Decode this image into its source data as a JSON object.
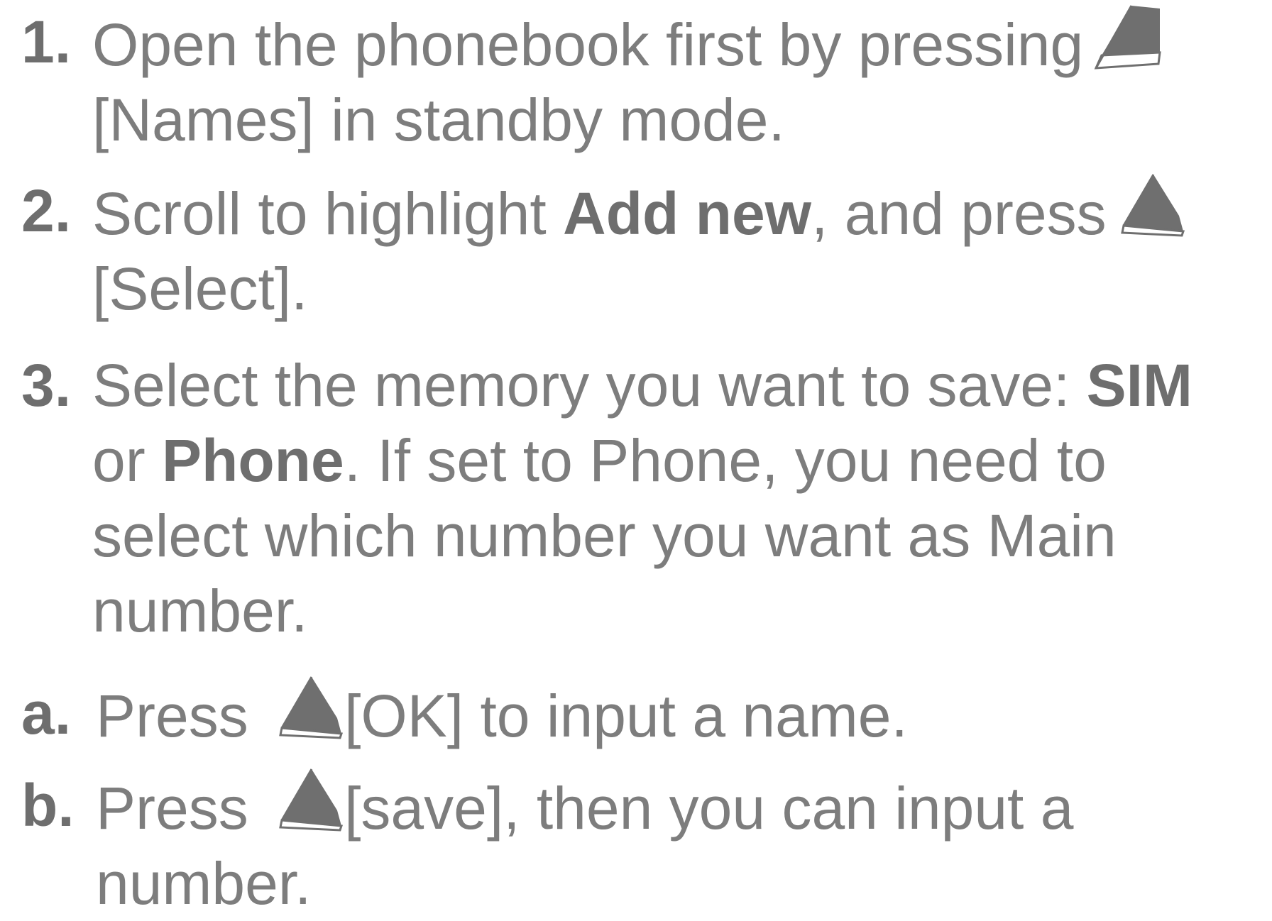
{
  "steps": [
    {
      "marker": "1.",
      "line1": "Open the phonebook first by pressing",
      "key_icon": "left-soft-key-icon",
      "line2": "[Names] in standby mode."
    },
    {
      "marker": "2.",
      "pre": "Scroll to highlight ",
      "bold": "Add new",
      "post": ", and press",
      "key_icon": "left-soft-key-icon",
      "line2": "[Select]."
    },
    {
      "marker": "3.",
      "pre": "Select the memory you want to save: ",
      "bold1": "SIM",
      "mid": "or ",
      "bold2": "Phone",
      "post": ". If set to Phone, you need to",
      "line3": "select which number you want as Main",
      "line4": "number."
    }
  ],
  "substeps": [
    {
      "marker": "a.",
      "pre": "Press",
      "key_icon": "left-soft-key-icon",
      "post": "[OK] to input a name."
    },
    {
      "marker": "b.",
      "pre": "Press",
      "key_icon": "left-soft-key-icon",
      "post": "[save], then you can input a",
      "line2": "number."
    }
  ],
  "colors": {
    "text": "#7d7d7d",
    "bold_text": "#6e6e6e",
    "key_fill": "#6f6f6f"
  }
}
